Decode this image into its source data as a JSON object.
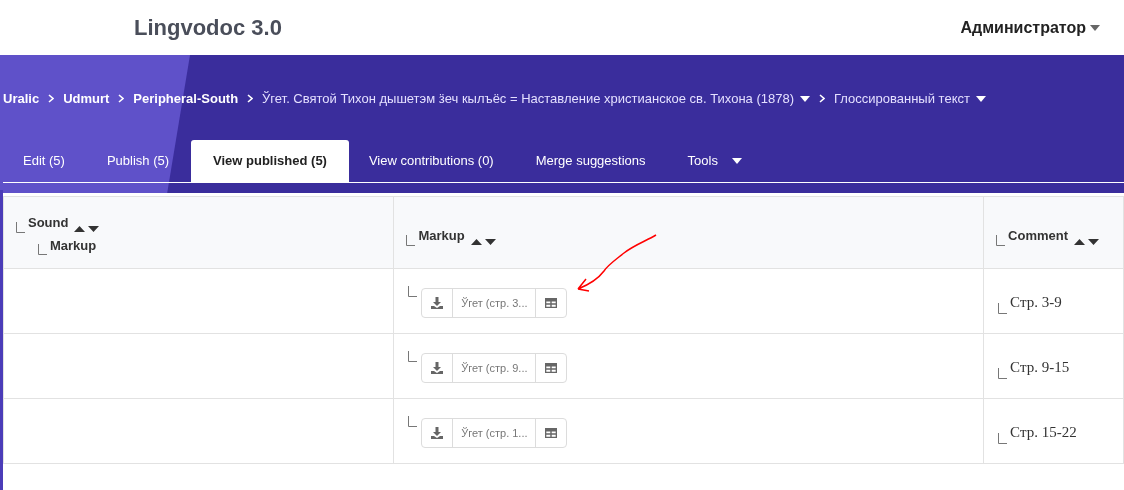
{
  "header": {
    "logo": "Lingvodoc 3.0",
    "user": "Администратор"
  },
  "breadcrumbs": [
    {
      "label": "Uralic",
      "dropdown": false
    },
    {
      "label": "Udmurt",
      "dropdown": false
    },
    {
      "label": "Peripheral-South",
      "dropdown": false
    },
    {
      "label": "Ўгет. Святой Тихон дышетэм ӟеч кылъёс = Наставление христианское св. Тихона (1878)",
      "dropdown": true
    },
    {
      "label": "Глоссированный текст",
      "dropdown": true
    }
  ],
  "tabs": [
    {
      "label": "Edit (5)",
      "selected": false,
      "dropdown": false
    },
    {
      "label": "Publish (5)",
      "selected": false,
      "dropdown": false
    },
    {
      "label": "View published (5)",
      "selected": true,
      "dropdown": false
    },
    {
      "label": "View contributions (0)",
      "selected": false,
      "dropdown": false
    },
    {
      "label": "Merge suggestions",
      "selected": false,
      "dropdown": false
    },
    {
      "label": "Tools",
      "selected": false,
      "dropdown": true
    }
  ],
  "table": {
    "columns": [
      {
        "label": "Sound",
        "children": [
          {
            "label": "Markup"
          }
        ]
      },
      {
        "label": "Markup"
      },
      {
        "label": "Comment"
      }
    ],
    "rows": [
      {
        "markup": "Ўгет (стр. 3...",
        "comment": "Стр. 3-9"
      },
      {
        "markup": "Ўгет (стр. 9...",
        "comment": "Стр. 9-15"
      },
      {
        "markup": "Ўгет (стр. 1...",
        "comment": "Стр. 15-22"
      }
    ]
  }
}
